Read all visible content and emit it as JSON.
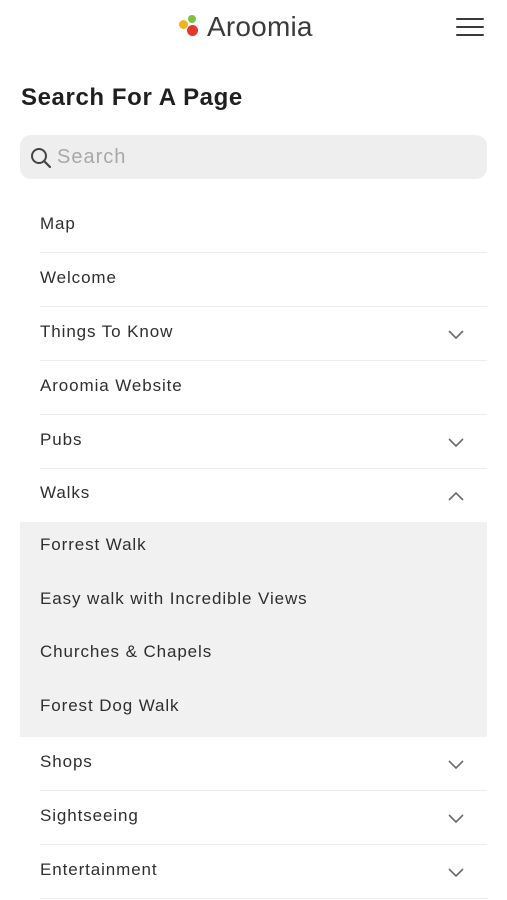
{
  "header": {
    "brand": "Aroomia",
    "menu_icon": "hamburger-menu-icon"
  },
  "page": {
    "title": "Search For A Page"
  },
  "search": {
    "placeholder": "Search",
    "value": "",
    "icon": "search-icon"
  },
  "nav": {
    "items": [
      {
        "label": "Map"
      },
      {
        "label": "Welcome"
      },
      {
        "label": "Things To Know",
        "expandable": true,
        "expanded": false
      },
      {
        "label": "Aroomia Website"
      },
      {
        "label": "Pubs",
        "expandable": true,
        "expanded": false
      },
      {
        "label": "Walks",
        "expandable": true,
        "expanded": true
      },
      {
        "label": "Shops",
        "expandable": true,
        "expanded": false
      },
      {
        "label": "Sightseeing",
        "expandable": true,
        "expanded": false
      },
      {
        "label": "Entertainment",
        "expandable": true,
        "expanded": false
      }
    ],
    "walks_children": [
      {
        "label": "Forrest Walk"
      },
      {
        "label": "Easy walk with Incredible Views"
      },
      {
        "label": "Churches & Chapels"
      },
      {
        "label": "Forest Dog Walk"
      }
    ]
  },
  "colors": {
    "logo_yellow": "#f2b21b",
    "logo_green": "#7cc242",
    "logo_red": "#e8362d",
    "submenu_bg": "#f2f1f1",
    "search_bg": "#eeeeee"
  }
}
